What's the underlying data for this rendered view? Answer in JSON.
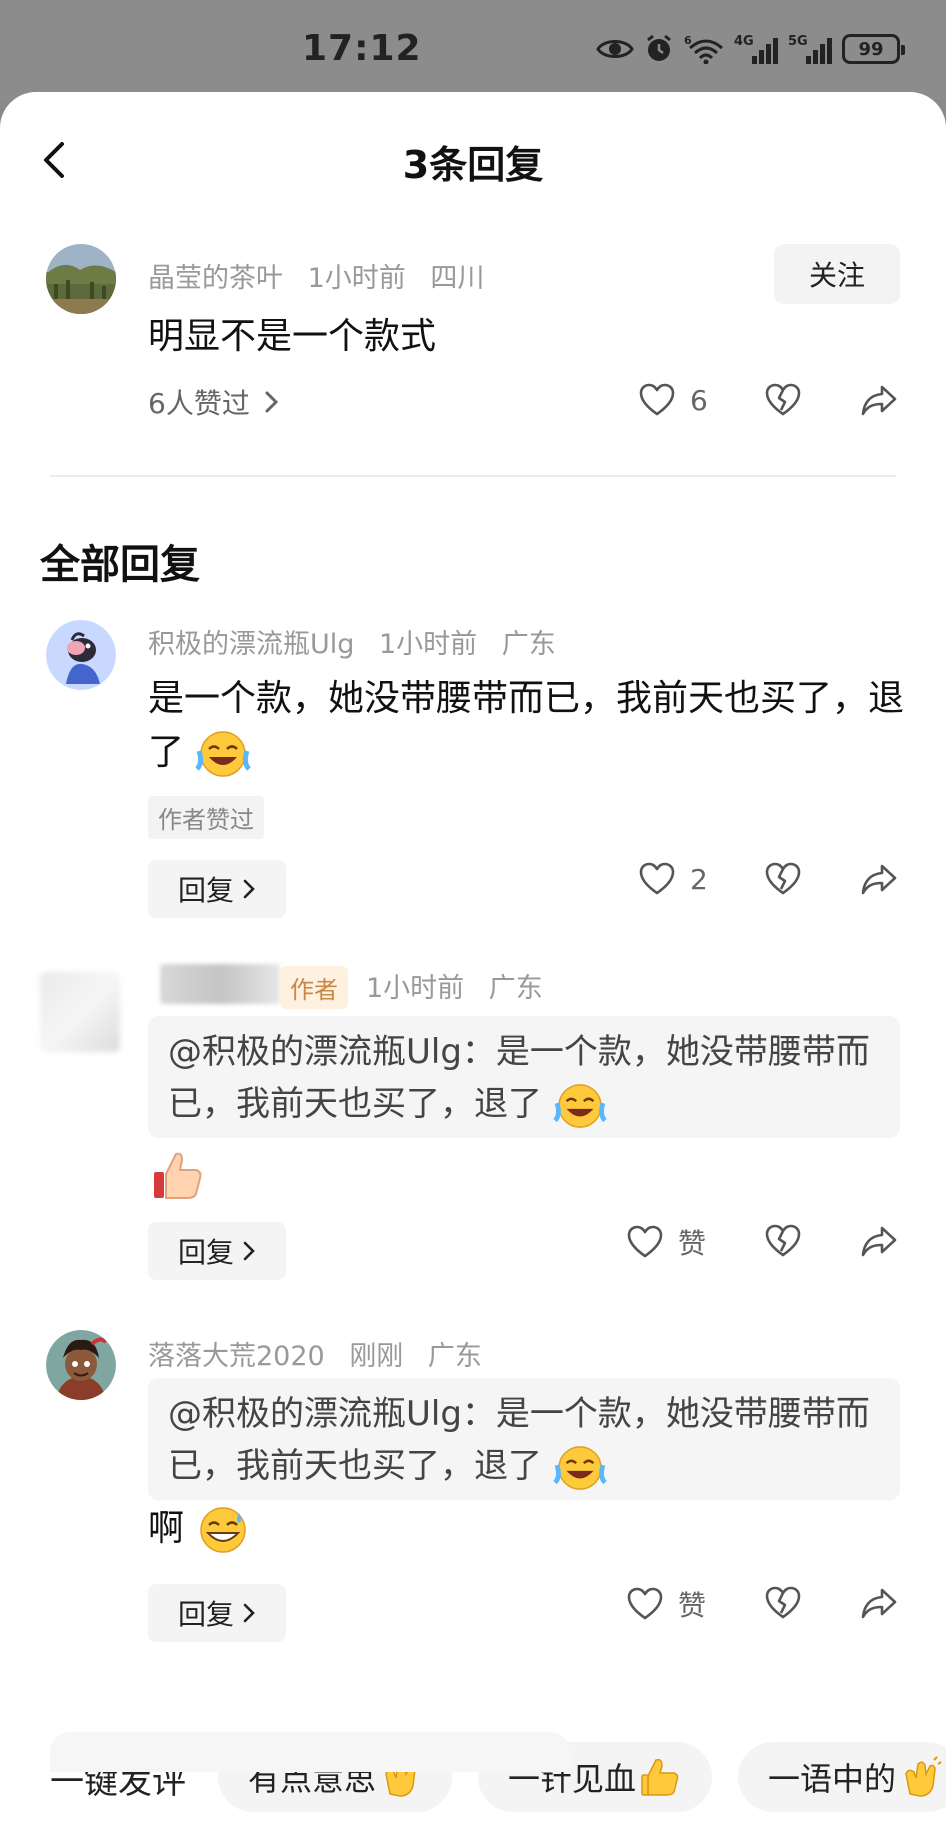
{
  "status_bar": {
    "time": "17:12",
    "battery": "99",
    "signal1_tag": "4G",
    "signal2_tag": "5G",
    "wifi_tag": "6"
  },
  "header": {
    "title": "3条回复",
    "back_icon": "chevron-left-icon"
  },
  "main_comment": {
    "username": "晶莹的茶叶",
    "time": "1小时前",
    "location": "四川",
    "follow_label": "关注",
    "content": "明显不是一个款式",
    "likes_summary": "6人赞过",
    "like_count": "6"
  },
  "replies_section": {
    "title": "全部回复",
    "replies": [
      {
        "username": "积极的漂流瓶Ulg",
        "time": "1小时前",
        "location": "广东",
        "content": "是一个款，她没带腰带而已，我前天也买了，退了",
        "badge": "作者赞过",
        "reply_label": "回复",
        "like_count": "2"
      },
      {
        "username": "",
        "author_tag": "作者",
        "time": "1小时前",
        "location": "广东",
        "quote": "@积极的漂流瓶Ulg：是一个款，她没带腰带而已，我前天也买了，退了",
        "reply_label": "回复",
        "like_label": "赞"
      },
      {
        "username": "落落大荒2020",
        "time": "刚刚",
        "location": "广东",
        "quote": "@积极的漂流瓶Ulg：是一个款，她没带腰带而已，我前天也买了，退了",
        "content": "啊",
        "reply_label": "回复",
        "like_label": "赞"
      }
    ]
  },
  "quick_reply": {
    "label": "一键发评",
    "chips": [
      "有点意思",
      "一针见血",
      "一语中的"
    ]
  }
}
